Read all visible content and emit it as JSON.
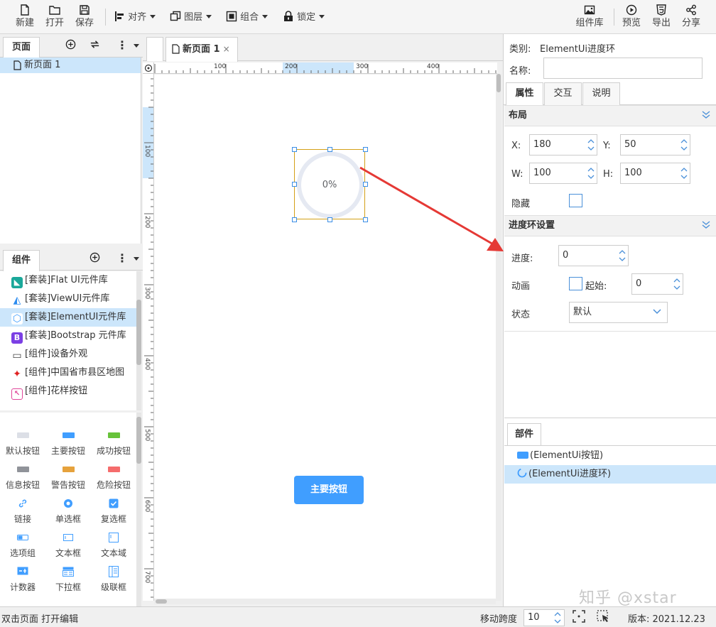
{
  "toolbar": {
    "new_label": "新建",
    "open_label": "打开",
    "save_label": "保存",
    "align_label": "对齐",
    "layer_label": "图层",
    "group_label": "组合",
    "lock_label": "锁定",
    "component_lib_label": "组件库",
    "preview_label": "预览",
    "export_label": "导出",
    "share_label": "分享"
  },
  "pages_panel": {
    "tab_label": "页面",
    "items": [
      {
        "label": "新页面 1",
        "selected": true
      }
    ]
  },
  "components_panel": {
    "tab_label": "组件",
    "libraries": [
      {
        "label": "[套装]Flat UI元件库",
        "icon": "flat-ui-icon",
        "color": "#1aa89a"
      },
      {
        "label": "[套装]ViewUI元件库",
        "icon": "view-ui-icon",
        "color": "#2d8cf0"
      },
      {
        "label": "[套装]ElementUI元件库",
        "icon": "element-ui-icon",
        "color": "#409eff",
        "selected": true
      },
      {
        "label": "[套装]Bootstrap 元件库",
        "icon": "bootstrap-icon",
        "color": "#7b3fe4"
      },
      {
        "label": "[组件]设备外观",
        "icon": "device-icon",
        "color": "#444444"
      },
      {
        "label": "[组件]中国省市县区地图",
        "icon": "china-map-icon",
        "color": "#e02020"
      },
      {
        "label": "[组件]花样按钮",
        "icon": "fancy-button-icon",
        "color": "#e0469a"
      }
    ]
  },
  "widgets": [
    {
      "label": "默认按钮",
      "icon": "default-button-icon",
      "color": "#dcdfe6"
    },
    {
      "label": "主要按钮",
      "icon": "primary-button-icon",
      "color": "#409eff"
    },
    {
      "label": "成功按钮",
      "icon": "success-button-icon",
      "color": "#67c23a"
    },
    {
      "label": "信息按钮",
      "icon": "info-button-icon",
      "color": "#909399"
    },
    {
      "label": "警告按钮",
      "icon": "warning-button-icon",
      "color": "#e6a23c"
    },
    {
      "label": "危险按钮",
      "icon": "danger-button-icon",
      "color": "#f56c6c"
    },
    {
      "label": "链接",
      "icon": "link-icon",
      "color": "#409eff"
    },
    {
      "label": "单选框",
      "icon": "radio-icon",
      "color": "#409eff"
    },
    {
      "label": "复选框",
      "icon": "checkbox-icon",
      "color": "#409eff"
    },
    {
      "label": "选项组",
      "icon": "option-group-icon",
      "color": "#409eff"
    },
    {
      "label": "文本框",
      "icon": "textbox-icon",
      "color": "#409eff"
    },
    {
      "label": "文本域",
      "icon": "textarea-icon",
      "color": "#409eff"
    },
    {
      "label": "计数器",
      "icon": "counter-icon",
      "color": "#409eff"
    },
    {
      "label": "下拉框",
      "icon": "dropdown-icon",
      "color": "#409eff"
    },
    {
      "label": "级联框",
      "icon": "cascader-icon",
      "color": "#409eff"
    }
  ],
  "document": {
    "tab_label": "新页面 1",
    "close_symbol": "×",
    "ruler_h_labels": [
      "100",
      "200",
      "300",
      "400"
    ],
    "ruler_v_labels": [
      "100",
      "200",
      "300",
      "400",
      "500",
      "600",
      "700"
    ],
    "progress_text": "0%",
    "main_button_label": "主要按钮"
  },
  "properties": {
    "category_label": "类别:",
    "category_value": "ElementUi进度环",
    "name_label": "名称:",
    "name_value": "",
    "tabs": [
      "属性",
      "交互",
      "说明"
    ],
    "layout_section": "布局",
    "x_label": "X:",
    "x_value": "180",
    "y_label": "Y:",
    "y_value": "50",
    "w_label": "W:",
    "w_value": "100",
    "h_label": "H:",
    "h_value": "100",
    "hidden_label": "隐藏",
    "progress_section": "进度环设置",
    "progress_label": "进度:",
    "progress_value": "0",
    "animation_label": "动画",
    "start_label": "起始:",
    "start_value": "0",
    "state_label": "状态",
    "state_value": "默认"
  },
  "parts": {
    "tab_label": "部件",
    "items": [
      {
        "label": "(ElementUi按钮)",
        "selected": false
      },
      {
        "label": "(ElementUi进度环)",
        "selected": true
      }
    ]
  },
  "watermark": "知乎 @xstar",
  "status": {
    "left_text": "双击页面 打开编辑",
    "step_label": "移动跨度",
    "step_value": "10",
    "version_label": "版本: 2021.12.23"
  },
  "colors": {
    "accent": "#409eff",
    "selection": "#cce6fb",
    "arrow": "#e53935"
  }
}
